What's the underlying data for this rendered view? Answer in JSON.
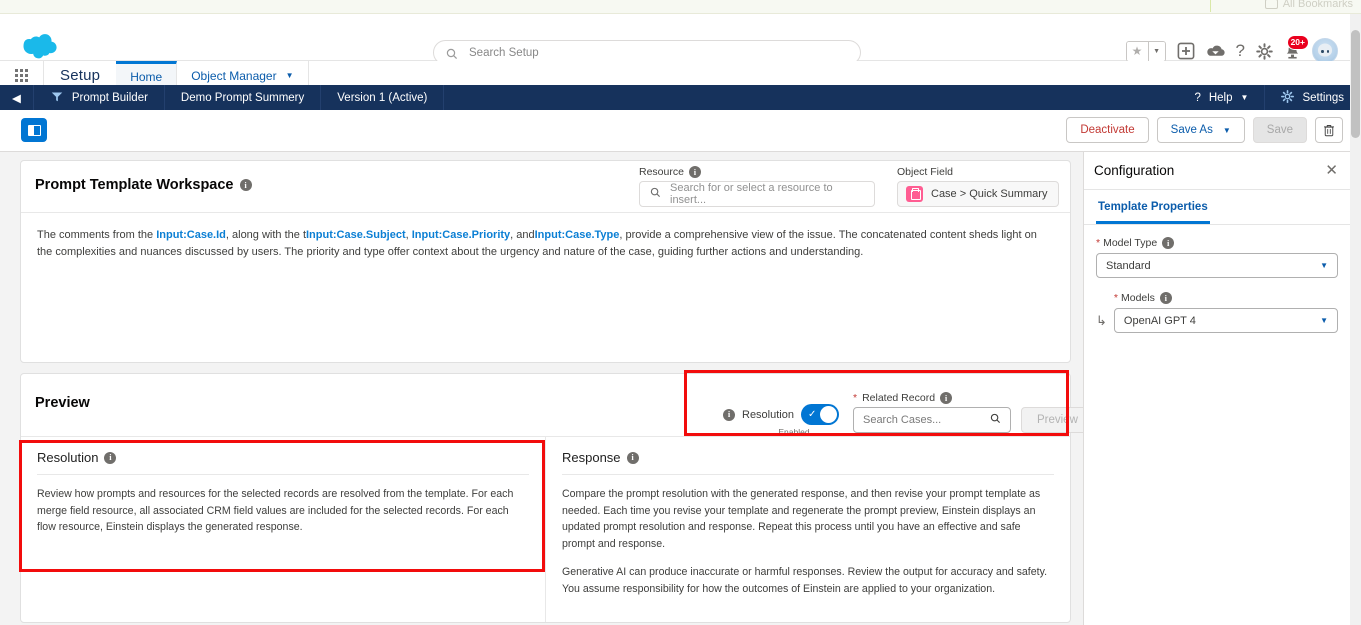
{
  "browser": {
    "bookmarks_label": "All Bookmarks",
    "bookmark_icon": "folder-icon"
  },
  "global_header": {
    "logo": "salesforce-cloud-logo",
    "search": {
      "placeholder": "Search Setup",
      "icon": "search-icon"
    },
    "icons": [
      {
        "name": "favorites-star-icon",
        "glyph": "★"
      },
      {
        "name": "favorites-dropdown-icon",
        "glyph": "▼"
      },
      {
        "name": "add-icon",
        "glyph": "+"
      },
      {
        "name": "deploy-cloud-icon",
        "glyph": "☁"
      },
      {
        "name": "help-icon",
        "glyph": "?"
      },
      {
        "name": "setup-gear-icon",
        "glyph": "✿"
      },
      {
        "name": "notifications-bell-icon",
        "glyph": "🔔"
      },
      {
        "name": "user-avatar",
        "glyph": ""
      }
    ],
    "notification_badge": "20+"
  },
  "setup_nav": {
    "app_launcher": "app-launcher-icon",
    "title": "Setup",
    "tabs": [
      {
        "label": "Home",
        "active": true
      },
      {
        "label": "Object Manager",
        "active": false,
        "caret": "▼"
      }
    ]
  },
  "prompt_band": {
    "back_icon": "◀",
    "builder_icon": "prompt-builder-icon",
    "builder_label": "Prompt Builder",
    "template_name": "Demo Prompt Summery",
    "version": "Version 1 (Active)",
    "help_icon": "?",
    "help_label": "Help",
    "help_caret": "▼",
    "settings_icon": "gear-icon",
    "settings_label": "Settings"
  },
  "toolbar": {
    "panel_toggle": "toggle-side-panel",
    "deactivate_label": "Deactivate",
    "save_as_label": "Save As",
    "save_as_caret": "▼",
    "save_label": "Save",
    "delete_icon": "trash-icon"
  },
  "workspace": {
    "title": "Prompt Template Workspace",
    "info_icon": "ⓘ",
    "resource": {
      "label": "Resource",
      "placeholder": "Search for or select a resource to insert...",
      "icon": "search-icon"
    },
    "object_field": {
      "label": "Object Field",
      "value": "Case > Quick Summary",
      "icon": "case-icon"
    },
    "prompt_segments": [
      {
        "text": "The comments from the ",
        "merge": false
      },
      {
        "text": "Input:Case.Id",
        "merge": true
      },
      {
        "text": ", along with the t",
        "merge": false
      },
      {
        "text": "Input:Case.Subject",
        "merge": true
      },
      {
        "text": ", ",
        "merge": false
      },
      {
        "text": "Input:Case.Priority",
        "merge": true
      },
      {
        "text": ", and",
        "merge": false
      },
      {
        "text": "Input:Case.Type",
        "merge": true
      },
      {
        "text": ", provide a comprehensive view of the issue. The concatenated content sheds light on the complexities and nuances discussed by users. The priority and type offer context about the urgency and nature of the case, guiding further actions and understanding.",
        "merge": false
      }
    ]
  },
  "preview": {
    "title": "Preview",
    "resolution_toggle": {
      "info_icon": "ⓘ",
      "label": "Resolution",
      "state_label": "Enabled",
      "checked": true,
      "check_glyph": "✓"
    },
    "related_record": {
      "label": "Related Record",
      "required_marker": "*",
      "placeholder": "Search Cases...",
      "search_icon": "search-icon"
    },
    "preview_button": "Preview",
    "panes": [
      {
        "title": "Resolution",
        "paragraphs": [
          "Review how prompts and resources for the selected records are resolved from the template. For each merge field resource, all associated CRM field values are included for the selected records. For each flow resource, Einstein displays the generated response."
        ]
      },
      {
        "title": "Response",
        "paragraphs": [
          "Compare the prompt resolution with the generated response, and then revise your prompt template as needed. Each time you revise your template and regenerate the prompt preview, Einstein displays an updated prompt resolution and response. Repeat this process until you have an effective and safe prompt and response.",
          "Generative AI can produce inaccurate or harmful responses. Review the output for accuracy and safety. You assume responsibility for how the outcomes of Einstein are applied to your organization."
        ]
      }
    ]
  },
  "configuration": {
    "title": "Configuration",
    "close_icon": "✕",
    "tab": "Template Properties",
    "model_type": {
      "label": "Model Type",
      "required_marker": "*",
      "value": "Standard",
      "caret": "▼"
    },
    "models": {
      "label": "Models",
      "required_marker": "*",
      "value": "OpenAI GPT 4",
      "caret": "▼",
      "indent_glyph": "↳"
    }
  },
  "colors": {
    "brand_blue": "#0176d3",
    "nav_dark": "#16325c",
    "highlight_red": "#f20c0c",
    "destructive": "#c23934",
    "case_pink": "#ff5d92"
  }
}
